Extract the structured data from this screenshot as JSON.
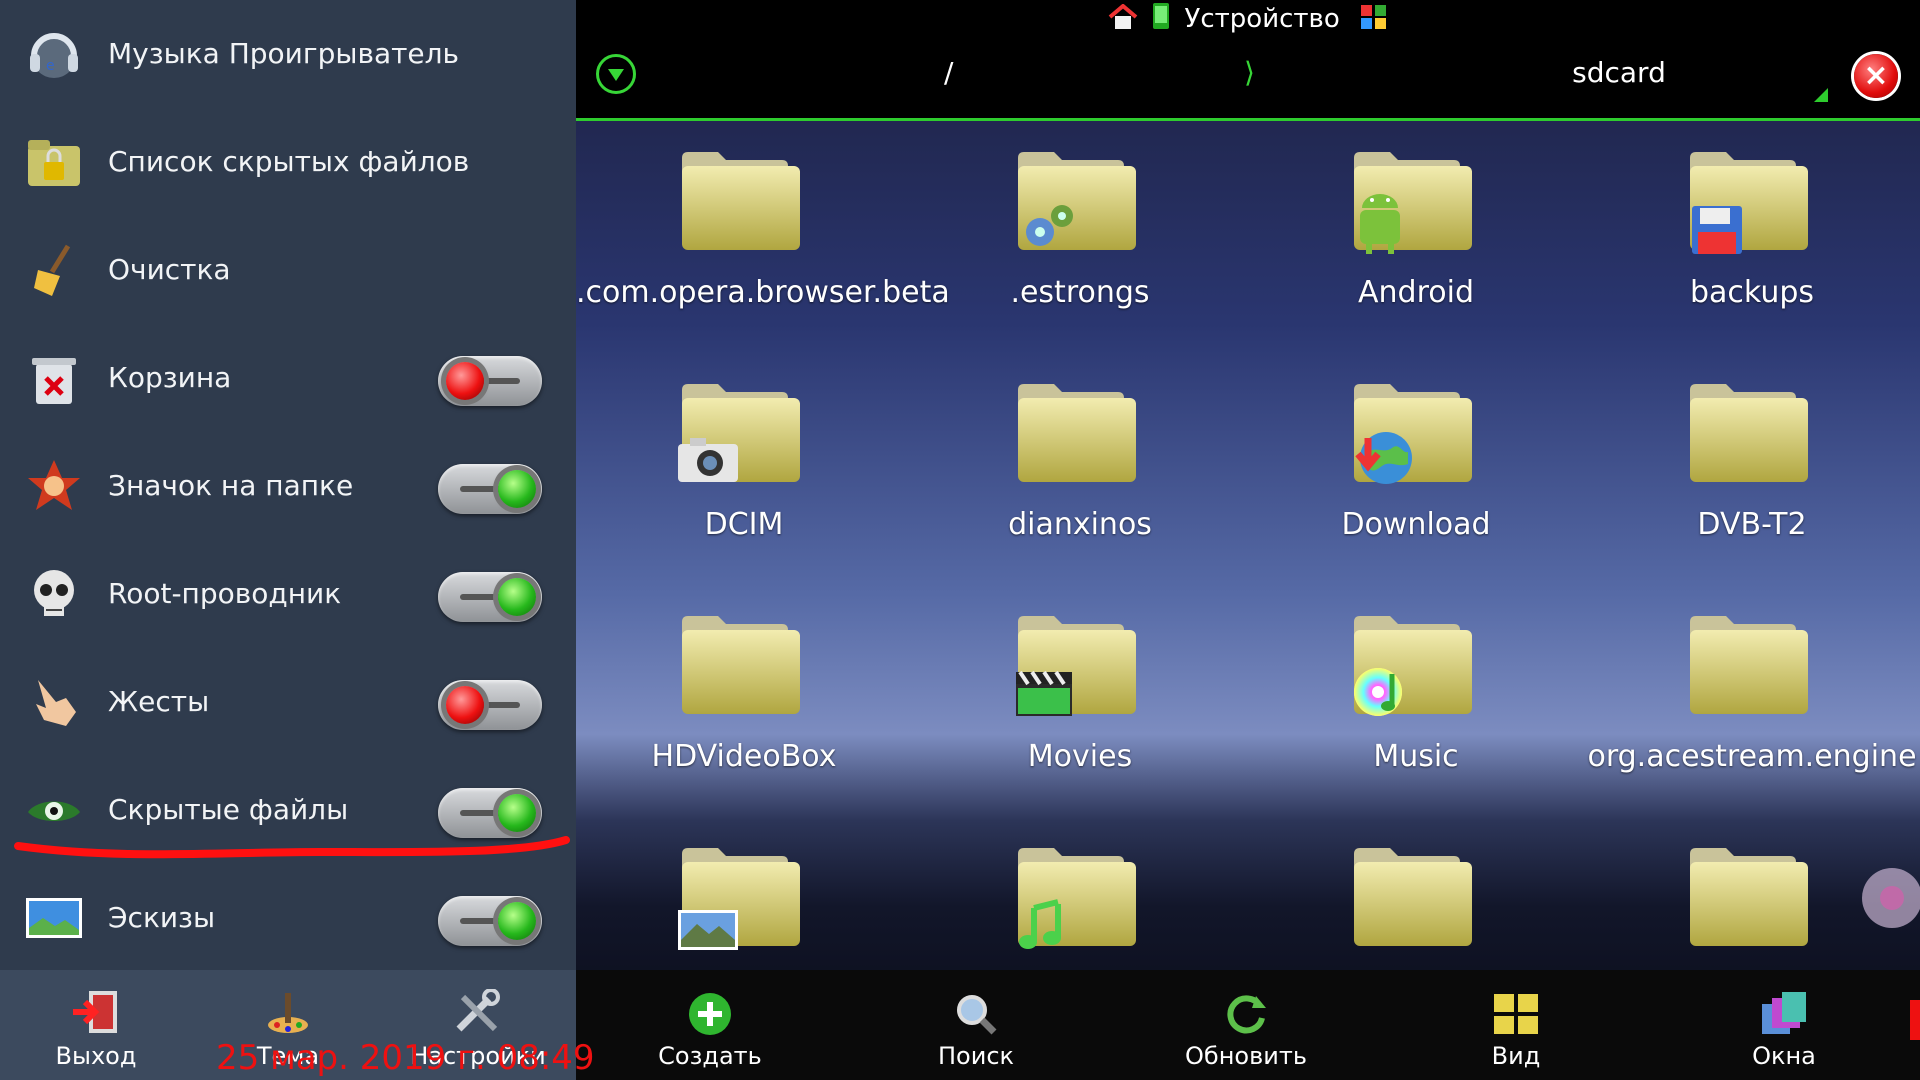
{
  "sidebar": {
    "items": [
      {
        "label": "Музыка Проигрыватель",
        "icon": "headphones-icon",
        "toggle": null
      },
      {
        "label": "Список скрытых файлов",
        "icon": "lock-folder-icon",
        "toggle": null
      },
      {
        "label": "Очистка",
        "icon": "broom-icon",
        "toggle": null
      },
      {
        "label": "Корзина",
        "icon": "trash-icon",
        "toggle": "off"
      },
      {
        "label": "Значок на папке",
        "icon": "badge-icon",
        "toggle": "on"
      },
      {
        "label": "Root-проводник",
        "icon": "skull-icon",
        "toggle": "on"
      },
      {
        "label": "Жесты",
        "icon": "hand-icon",
        "toggle": "off"
      },
      {
        "label": "Скрытые файлы",
        "icon": "eye-icon",
        "toggle": "on"
      },
      {
        "label": "Эскизы",
        "icon": "thumbnail-icon",
        "toggle": "on"
      }
    ],
    "bottom": [
      {
        "label": "Выход",
        "icon": "exit-icon"
      },
      {
        "label": "Тема",
        "icon": "theme-icon"
      },
      {
        "label": "Настройки",
        "icon": "settings-tools-icon"
      }
    ]
  },
  "topbar": {
    "title": "Устройство"
  },
  "path": {
    "root": "/",
    "separator": "⟩",
    "current": "sdcard"
  },
  "folders": [
    {
      "name": ".com.opera.browser.beta",
      "badge": null
    },
    {
      "name": ".estrongs",
      "badge": "gears"
    },
    {
      "name": "Android",
      "badge": "android"
    },
    {
      "name": "backups",
      "badge": "floppy"
    },
    {
      "name": "DCIM",
      "badge": "camera"
    },
    {
      "name": "dianxinos",
      "badge": null
    },
    {
      "name": "Download",
      "badge": "globe"
    },
    {
      "name": "DVB-T2",
      "badge": null
    },
    {
      "name": "HDVideoBox",
      "badge": null
    },
    {
      "name": "Movies",
      "badge": "clapper"
    },
    {
      "name": "Music",
      "badge": "disc"
    },
    {
      "name": "org.acestream.engine",
      "badge": null
    },
    {
      "name": "",
      "badge": "picture"
    },
    {
      "name": "",
      "badge": "note"
    },
    {
      "name": "",
      "badge": null
    },
    {
      "name": "",
      "badge": null
    }
  ],
  "toolbar": [
    {
      "label": "Создать",
      "icon": "add-icon"
    },
    {
      "label": "Поиск",
      "icon": "search-icon"
    },
    {
      "label": "Обновить",
      "icon": "refresh-icon"
    },
    {
      "label": "Вид",
      "icon": "view-grid-icon"
    },
    {
      "label": "Окна",
      "icon": "windows-icon"
    }
  ],
  "datetime": "25 мар. 2019 г. 08:49",
  "colors": {
    "accent": "#2ecc2e",
    "sidebar": "#2f3b4d",
    "alert": "#ee1111"
  }
}
